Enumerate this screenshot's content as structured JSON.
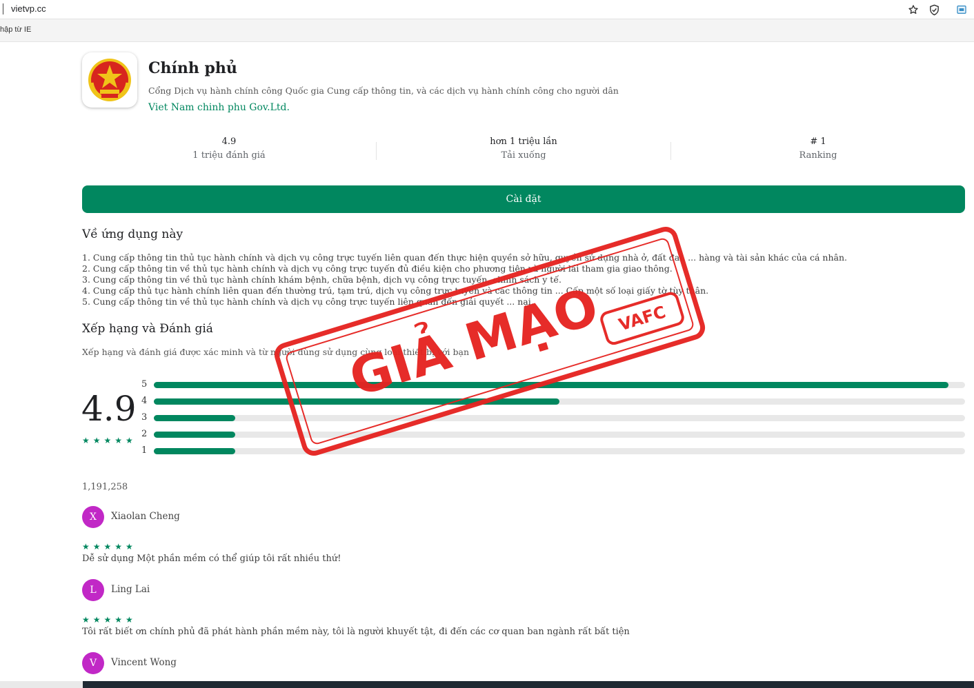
{
  "browser": {
    "url": "vietvp.cc",
    "bookmark": "hập từ IE",
    "icons": [
      "star-icon",
      "shield-icon",
      "extension-icon"
    ]
  },
  "app": {
    "title": "Chính phủ",
    "description": "Cổng Dịch vụ hành chính công Quốc gia Cung cấp thông tin, và các dịch vụ hành chính công cho người dân",
    "developer": "Viet Nam chinh phu Gov.Ltd."
  },
  "stats": [
    {
      "value": "4.9",
      "label": "1 triệu đánh giá"
    },
    {
      "value": "hơn 1 triệu lần",
      "label": "Tải xuống"
    },
    {
      "value": "# 1",
      "label": "Ranking"
    }
  ],
  "install_label": "Cài đặt",
  "about": {
    "title": "Về ứng dụng này",
    "items": [
      "1. Cung cấp thông tin thủ tục hành chính và dịch vụ công trực tuyến liên quan đến thực hiện quyền sở hữu, quyền sử dụng nhà ở, đất đai, ... hàng và tài sản khác của cá nhân.",
      "2. Cung cấp thông tin về thủ tục hành chính và dịch vụ công trực tuyến đủ điều kiện cho phương tiện và người lái tham gia giao thông.",
      "3. Cung cấp thông tin về thủ tục hành chính khám bệnh, chữa bệnh, dịch vụ công trực tuyến, chính sách y tế.",
      "4. Cung cấp thủ tục hành chính liên quan đến thường trú, tạm trú, dịch vụ công trực tuyến và các thông tin ... Cấp một số loại giấy tờ tùy thân.",
      "5. Cung cấp thông tin về thủ tục hành chính và dịch vụ công trực tuyến liên quan đến giải quyết ... nại."
    ]
  },
  "ratings": {
    "title": "Xếp hạng và Đánh giá",
    "note": "Xếp hạng và đánh giá được xác minh và từ người dùng sử dụng cùng loại thiết bị với bạn",
    "score": "4.9",
    "stars": "★★★★★",
    "total": "1,191,258",
    "histogram": [
      {
        "label": "5",
        "fraction": 0.98
      },
      {
        "label": "4",
        "fraction": 0.5
      },
      {
        "label": "3",
        "fraction": 0.1
      },
      {
        "label": "2",
        "fraction": 0.1
      },
      {
        "label": "1",
        "fraction": 0.1
      }
    ]
  },
  "reviews": [
    {
      "initial": "X",
      "name": "Xiaolan Cheng",
      "stars": "★★★★★",
      "text": "Dễ sử dụng Một phần mềm có thể giúp tôi rất nhiều thứ!"
    },
    {
      "initial": "L",
      "name": "Ling Lai",
      "stars": "★★★★★",
      "text": "Tôi rất biết ơn chính phủ đã phát hành phần mềm này, tôi là người khuyết tật, đi đến các cơ quan ban ngành rất bất tiện"
    },
    {
      "initial": "V",
      "name": "Vincent Wong"
    }
  ],
  "stamp": {
    "text": "GIẢ MẠO",
    "badge": "VAFC",
    "color": "#e52421"
  },
  "colors": {
    "accent": "#01875f",
    "avatar": "#c128c6"
  }
}
